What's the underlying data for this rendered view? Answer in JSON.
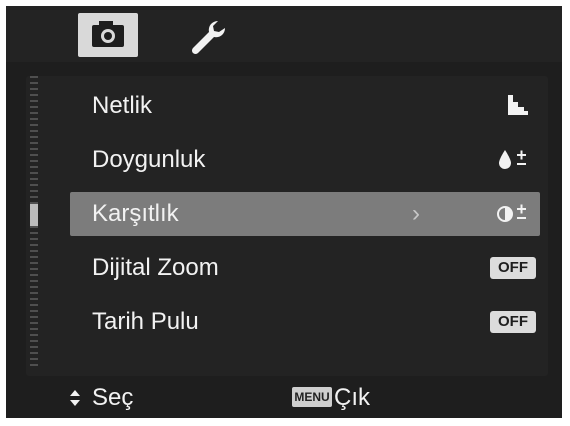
{
  "tabs": [
    {
      "icon": "camera-icon",
      "selected": false
    },
    {
      "icon": "wrench-icon",
      "selected": true
    }
  ],
  "menu": {
    "items": [
      {
        "label": "Netlik",
        "icon": "sharpness-icon"
      },
      {
        "label": "Doygunluk",
        "icon": "saturation-icon"
      },
      {
        "label": "Karşıtlık",
        "icon": "contrast-icon",
        "selected": true
      },
      {
        "label": "Dijital Zoom",
        "value": "OFF"
      },
      {
        "label": "Tarih Pulu",
        "value": "OFF"
      }
    ]
  },
  "statusbar": {
    "select_label": "Seç",
    "menu_button": "MENU",
    "exit_label": "Çık"
  },
  "colors": {
    "background": "#1e1e1e",
    "highlight": "#7c7c7c",
    "text": "#f2f2f2"
  }
}
